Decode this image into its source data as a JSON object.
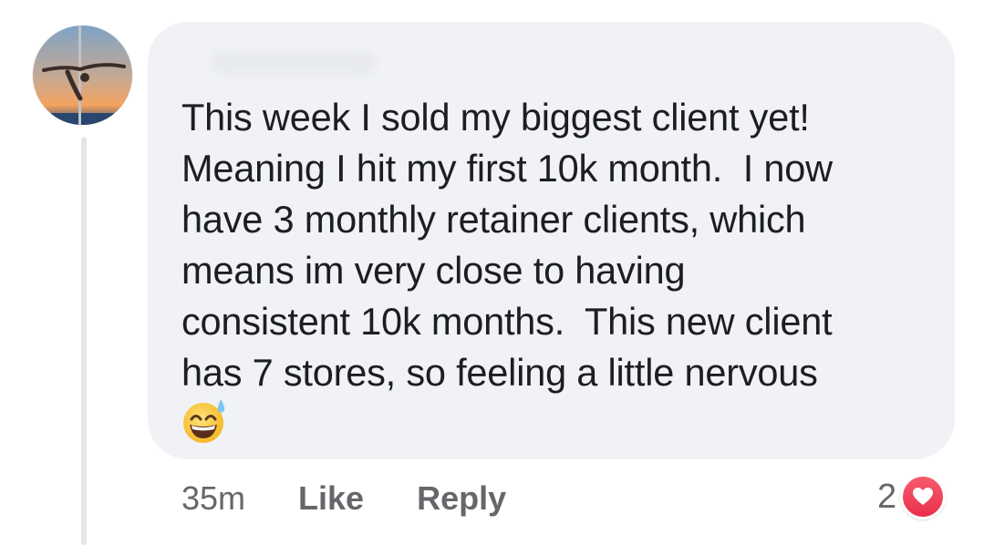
{
  "comment": {
    "text": "This week I sold my biggest client yet!\nMeaning I hit my first 10k month.  I now\nhave 3 monthly retainer clients, which\nmeans im very close to having\nconsistent 10k months.  This new client\nhas 7 stores, so feeling a little nervous",
    "emoji": "grinning-face-with-sweat-emoji"
  },
  "actions": {
    "time": "35m",
    "like_label": "Like",
    "reply_label": "Reply"
  },
  "reactions": {
    "count": "2",
    "type": "heart-icon",
    "color": "#f0284a"
  },
  "colors": {
    "bubble": "#f0f2f5",
    "text": "#1c1e21",
    "meta": "#65676b"
  }
}
